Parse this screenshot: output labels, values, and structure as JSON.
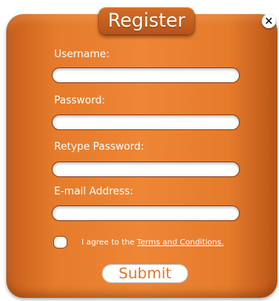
{
  "dialog": {
    "title": "Register",
    "close_symbol": "×"
  },
  "form": {
    "username": {
      "label": "Username:",
      "value": "",
      "placeholder": ""
    },
    "password": {
      "label": "Password:",
      "value": "",
      "placeholder": ""
    },
    "retype_password": {
      "label": "Retype Password:",
      "value": "",
      "placeholder": ""
    },
    "email": {
      "label": "E-mail Address:",
      "value": "",
      "placeholder": ""
    },
    "agree": {
      "checked": false,
      "text": "I agree to the ",
      "link_text": "Terms and Conditions."
    },
    "submit_label": "Submit"
  },
  "colors": {
    "panel_orange": "#e57b2b",
    "title_tab": "#c0601f",
    "submit_text": "#e0782a"
  },
  "icons": {
    "close": "close-icon"
  }
}
